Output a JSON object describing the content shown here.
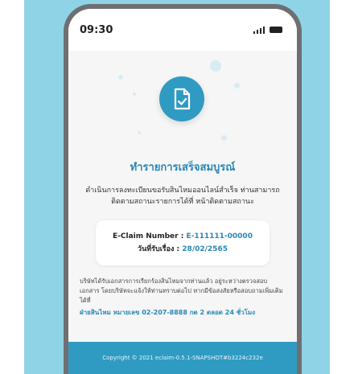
{
  "status": {
    "time": "09:30"
  },
  "hero": {
    "icon": "document-check-icon"
  },
  "result": {
    "title": "ทำรายการเสร็จสมบูรณ์",
    "description": "ดำเนินการลงทะเบียนขอรับสินไหมออนไลน์สำเร็จ ท่านสามารถติดตามสถานะรายการได้ที่ หน้าติดตามสถานะ"
  },
  "claim": {
    "number_label": "E-Claim Number : ",
    "number_value": "E-111111-00000",
    "date_label": "วันที่รับเรื่อง : ",
    "date_value": "28/02/2565"
  },
  "note": {
    "text": "บริษัทได้รับเอกสารการเรียกร้องสินไหมจากท่านแล้ว อยู่ระหว่างตรวจสอบเอกสาร โดยบริษัทจะแจ้งให้ท่านทราบต่อไป หากมีข้อสงสัยหรือสอบถามเพิ่มเติมได้ที่",
    "hotline": "ฝ่ายสินไหม หมายเลข 02-207-8888 กด 2 ตลอด 24 ชั่วโมง"
  },
  "footer": {
    "copyright": "Copyright © 2021 eclaim-0.5.1-SNAPSHOT#b3224c232e"
  },
  "colors": {
    "primary": "#2f9bc2",
    "accent_text": "#2a87b5",
    "background": "#8fd3e6"
  }
}
